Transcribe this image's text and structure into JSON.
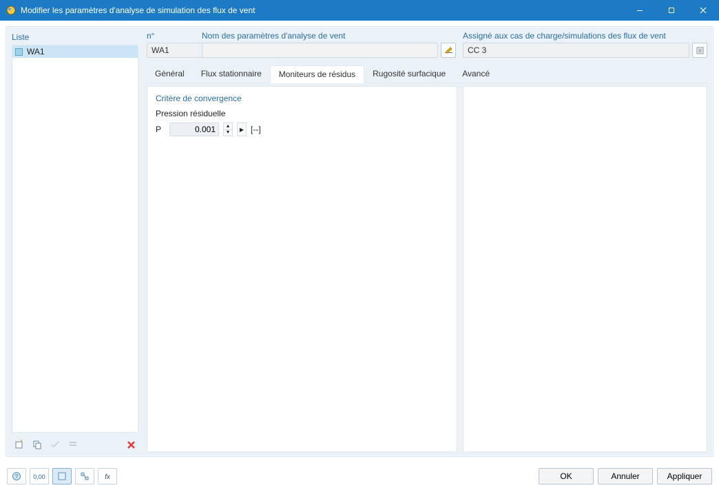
{
  "titlebar": {
    "text": "Modifier les paramètres d'analyse de simulation des flux de vent"
  },
  "left": {
    "header": "Liste",
    "item": "WA1"
  },
  "fields": {
    "number_label": "n°",
    "number_value": "WA1",
    "name_label": "Nom des paramètres d'analyse de vent",
    "name_value": "",
    "assign_label": "Assigné aux cas de charge/simulations des flux de vent",
    "assign_value": "CC 3"
  },
  "tabs": {
    "general": "Général",
    "steady": "Flux stationnaire",
    "residual": "Moniteurs de résidus",
    "roughness": "Rugosité surfacique",
    "advanced": "Avancé"
  },
  "content": {
    "section": "Critère de convergence",
    "label": "Pression résiduelle",
    "symbol": "P",
    "value": "0.001",
    "unit": "[--]"
  },
  "footer": {
    "ok": "OK",
    "cancel": "Annuler",
    "apply": "Appliquer"
  }
}
